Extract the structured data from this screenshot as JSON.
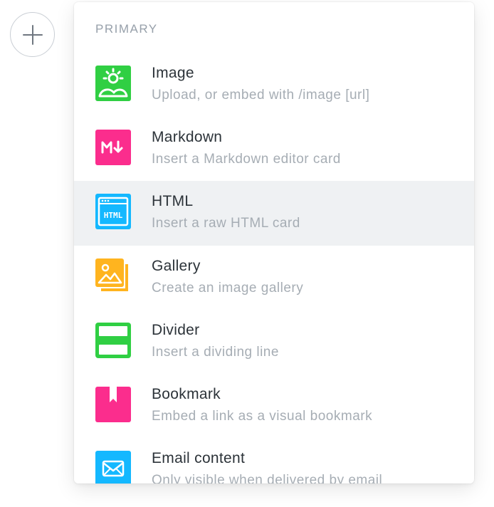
{
  "section": {
    "label": "PRIMARY"
  },
  "items": [
    {
      "title": "Image",
      "description": "Upload, or embed with /image [url]",
      "icon": "image-icon",
      "color": "#30cf43"
    },
    {
      "title": "Markdown",
      "description": "Insert a Markdown editor card",
      "icon": "markdown-icon",
      "color": "#fb2d8d"
    },
    {
      "title": "HTML",
      "description": "Insert a raw HTML card",
      "icon": "html-icon",
      "color": "#14b8ff"
    },
    {
      "title": "Gallery",
      "description": "Create an image gallery",
      "icon": "gallery-icon",
      "color": "#ffb41f"
    },
    {
      "title": "Divider",
      "description": "Insert a dividing line",
      "icon": "divider-icon",
      "color": "#30cf43"
    },
    {
      "title": "Bookmark",
      "description": "Embed a link as a visual bookmark",
      "icon": "bookmark-icon",
      "color": "#fb2d8d"
    },
    {
      "title": "Email content",
      "description": "Only visible when delivered by email",
      "icon": "email-icon",
      "color": "#14b8ff"
    }
  ],
  "selected_index": 2
}
